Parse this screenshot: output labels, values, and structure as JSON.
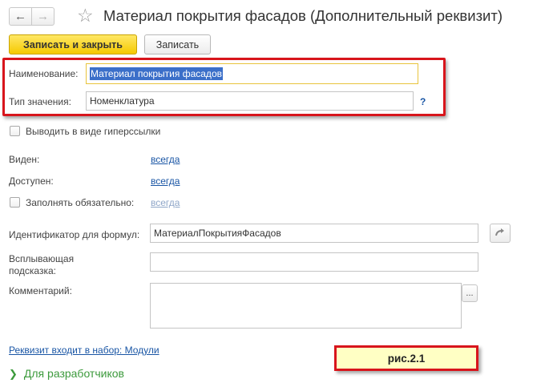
{
  "header": {
    "back_icon": "arrow-left-icon",
    "forward_icon": "arrow-right-icon",
    "favorite_icon": "star-icon",
    "title": "Материал покрытия фасадов (Дополнительный реквизит)"
  },
  "toolbar": {
    "save_close_label": "Записать и закрыть",
    "save_label": "Записать"
  },
  "form": {
    "name_label": "Наименование:",
    "name_value": "Материал покрытия фасадов",
    "type_label": "Тип значения:",
    "type_value": "Номенклатура",
    "type_help": "?",
    "hyperlink_label": "Выводить в виде гиперссылки",
    "visible_label": "Виден:",
    "visible_value": "всегда",
    "available_label": "Доступен:",
    "available_value": "всегда",
    "required_label": "Заполнять обязательно:",
    "required_value": "всегда",
    "formula_id_label": "Идентификатор для формул:",
    "formula_id_value": "МатериалПокрытияФасадов",
    "tooltip_label_line1": "Всплывающая",
    "tooltip_label_line2": "подсказка:",
    "tooltip_value": "",
    "comment_label": "Комментарий:",
    "comment_value": "",
    "comment_button": "...",
    "set_link": "Реквизит входит в набор: Модули",
    "developers_group": "Для разработчиков"
  },
  "annotation": {
    "label": "рис.2.1"
  },
  "colors": {
    "accent_yellow": "#f5c900",
    "highlight_red": "#d8151c",
    "link_blue": "#1a56a5",
    "group_green": "#3c9a3c",
    "selection_blue": "#3b6fc9"
  }
}
